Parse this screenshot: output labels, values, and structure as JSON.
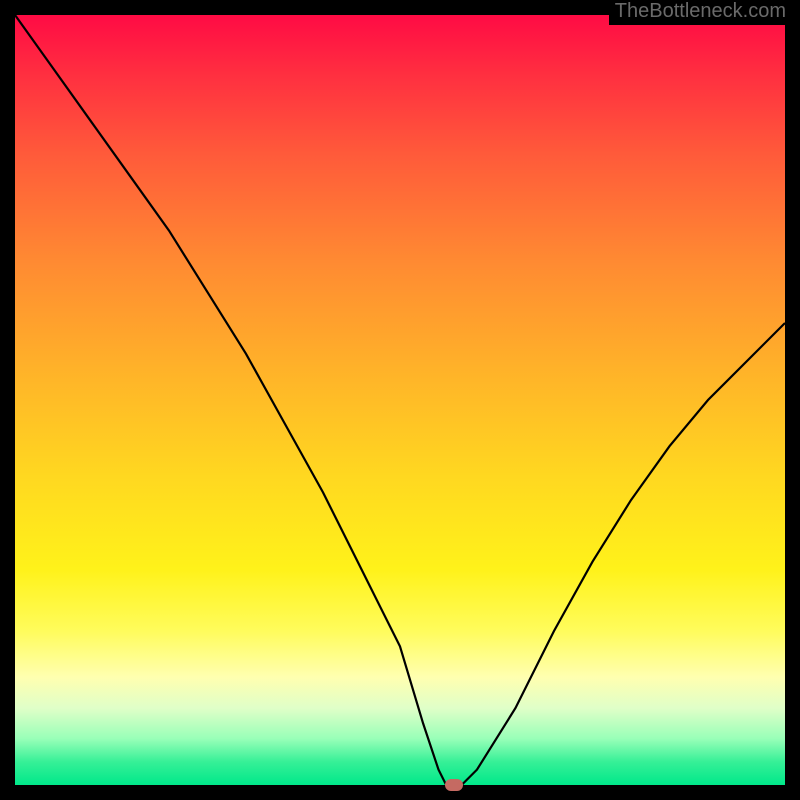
{
  "watermark": "TheBottleneck.com",
  "chart_data": {
    "type": "line",
    "x": [
      0,
      5,
      10,
      15,
      20,
      25,
      30,
      35,
      40,
      45,
      50,
      53,
      55,
      56,
      57,
      58,
      60,
      65,
      70,
      75,
      80,
      85,
      90,
      95,
      100
    ],
    "y": [
      100,
      93,
      86,
      79,
      72,
      64,
      56,
      47,
      38,
      28,
      18,
      8,
      2,
      0,
      0,
      0,
      2,
      10,
      20,
      29,
      37,
      44,
      50,
      55,
      60
    ],
    "xlim": [
      0,
      100
    ],
    "ylim": [
      0,
      100
    ],
    "xlabel": "",
    "ylabel": "",
    "title": "",
    "marker": {
      "x": 57,
      "y": 0
    }
  }
}
